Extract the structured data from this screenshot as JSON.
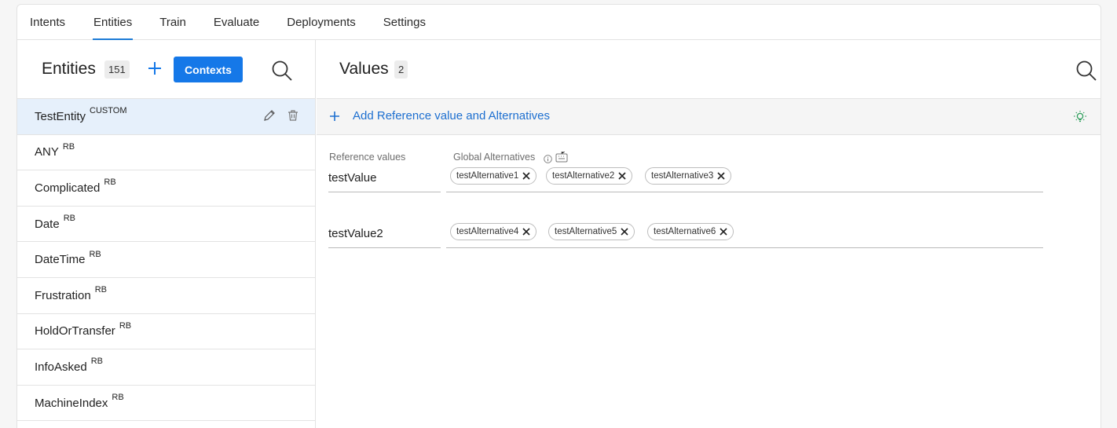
{
  "tabs": [
    "Intents",
    "Entities",
    "Train",
    "Evaluate",
    "Deployments",
    "Settings"
  ],
  "entities_panel": {
    "title": "Entities",
    "count": "151",
    "contexts_label": "Contexts",
    "items": [
      {
        "name": "TestEntity",
        "tag": "CUSTOM",
        "selected": true
      },
      {
        "name": "ANY",
        "tag": "RB"
      },
      {
        "name": "Complicated",
        "tag": "RB"
      },
      {
        "name": "Date",
        "tag": "RB"
      },
      {
        "name": "DateTime",
        "tag": "RB"
      },
      {
        "name": "Frustration",
        "tag": "RB"
      },
      {
        "name": "HoldOrTransfer",
        "tag": "RB"
      },
      {
        "name": "InfoAsked",
        "tag": "RB"
      },
      {
        "name": "MachineIndex",
        "tag": "RB"
      }
    ]
  },
  "values_panel": {
    "title": "Values",
    "count": "2",
    "add_label": "Add Reference value and Alternatives",
    "reference_label": "Reference values",
    "alternatives_label": "Global Alternatives",
    "rows": [
      {
        "reference": "testValue",
        "alternatives": [
          "testAlternative1",
          "testAlternative2",
          "testAlternative3"
        ]
      },
      {
        "reference": "testValue2",
        "alternatives": [
          "testAlternative4",
          "testAlternative5",
          "testAlternative6"
        ]
      }
    ]
  },
  "icons": {
    "search": "search-icon",
    "add": "plus-icon",
    "edit": "pencil-icon",
    "delete": "trash-icon",
    "info": "info-icon",
    "keyboard": "keyboard-icon",
    "hint": "lightbulb-icon",
    "remove": "close-icon"
  },
  "colors": {
    "accent": "#1578e8",
    "link": "#1d6fd0",
    "selected_row": "#e6f0fb",
    "hint": "#2e9e5b"
  }
}
